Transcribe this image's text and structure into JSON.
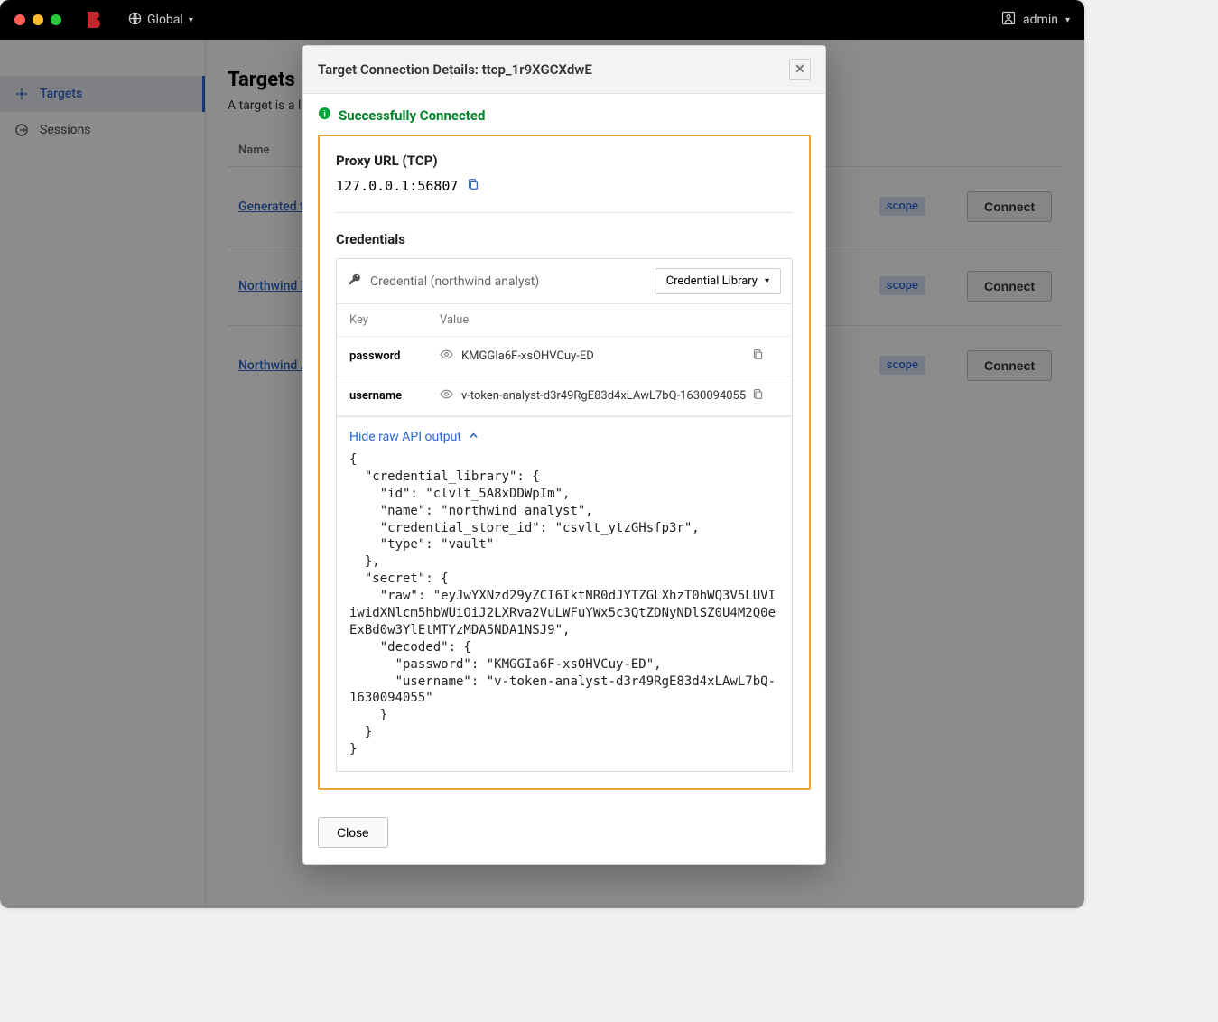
{
  "titlebar": {
    "scope_label": "Global",
    "user_label": "admin"
  },
  "sidebar": {
    "items": [
      {
        "label": "Targets",
        "active": true
      },
      {
        "label": "Sessions",
        "active": false
      }
    ]
  },
  "page": {
    "title": "Targets",
    "description_visible": "A target is a l"
  },
  "targets_table": {
    "columns": [
      "Name"
    ],
    "rows": [
      {
        "name_visible": "Generated t",
        "scope_visible": "scope",
        "connect_label": "Connect"
      },
      {
        "name_visible": "Northwind D",
        "scope_visible": "scope",
        "connect_label": "Connect"
      },
      {
        "name_visible": "Northwind A",
        "scope_visible": "scope",
        "connect_label": "Connect"
      }
    ]
  },
  "modal": {
    "title": "Target Connection Details: ttcp_1r9XGCXdwE",
    "status": "Successfully Connected",
    "proxy_section_title": "Proxy URL (TCP)",
    "proxy_url": "127.0.0.1:56807",
    "credentials_title": "Credentials",
    "credential_name": "Credential (northwind analyst)",
    "credential_lib_button": "Credential Library",
    "cred_columns": {
      "key": "Key",
      "value": "Value"
    },
    "cred_rows": [
      {
        "key": "password",
        "value": "KMGGIa6F-xsOHVCuy-ED"
      },
      {
        "key": "username",
        "value": "v-token-analyst-d3r49RgE83d4xLAwL7bQ-1630094055"
      }
    ],
    "raw_toggle_label": "Hide raw API output",
    "raw_output": "{\n  \"credential_library\": {\n    \"id\": \"clvlt_5A8xDDWpIm\",\n    \"name\": \"northwind analyst\",\n    \"credential_store_id\": \"csvlt_ytzGHsfp3r\",\n    \"type\": \"vault\"\n  },\n  \"secret\": {\n    \"raw\": \"eyJwYXNzd29yZCI6IktNR0dJYTZGLXhzT0hWQ3V5LUVIiwidXNlcm5hbWUiOiJ2LXRva2VuLWFuYWx5c3QtZDNyNDlSZ0U4M2Q0eExBd0w3YlEtMTYzMDA5NDA1NSJ9\",\n    \"decoded\": {\n      \"password\": \"KMGGIa6F-xsOHVCuy-ED\",\n      \"username\": \"v-token-analyst-d3r49RgE83d4xLAwL7bQ-1630094055\"\n    }\n  }\n}",
    "close_label": "Close"
  }
}
